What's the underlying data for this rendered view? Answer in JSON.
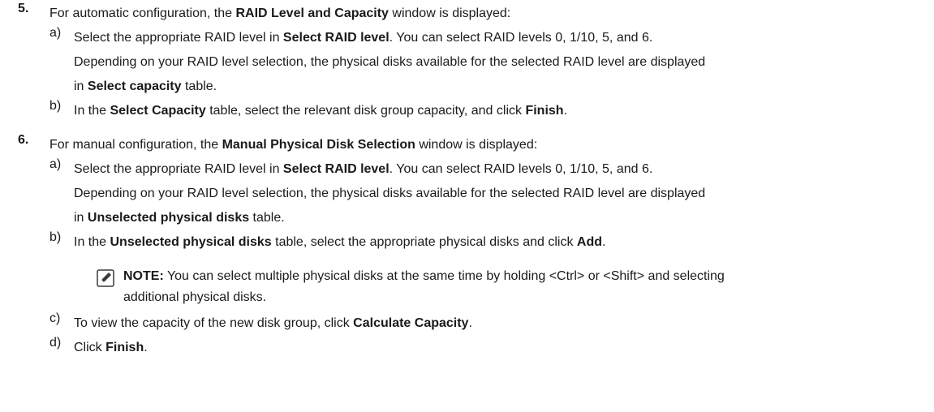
{
  "steps": [
    {
      "number": "5.",
      "intro": {
        "t1": "For automatic configuration, the ",
        "b1": "RAID Level and Capacity",
        "t2": " window is displayed:"
      },
      "substeps": [
        {
          "letter": "a)",
          "line1": {
            "t1": "Select the appropriate RAID level in ",
            "b1": "Select RAID level",
            "t2": ". You can select RAID levels 0, 1/10, 5, and 6."
          },
          "line2": "Depending on your RAID level selection, the physical disks available for the selected RAID level are displayed",
          "line3": {
            "t1": "in ",
            "b1": "Select capacity",
            "t2": " table."
          }
        },
        {
          "letter": "b)",
          "line1": {
            "t1": "In the ",
            "b1": "Select Capacity",
            "t2": " table, select the relevant disk group capacity, and click ",
            "b2": "Finish",
            "t3": "."
          }
        }
      ]
    },
    {
      "number": "6.",
      "intro": {
        "t1": "For manual configuration, the ",
        "b1": "Manual Physical Disk Selection",
        "t2": " window is displayed:"
      },
      "substeps": [
        {
          "letter": "a)",
          "line1": {
            "t1": "Select the appropriate RAID level in ",
            "b1": "Select RAID level",
            "t2": ". You can select RAID levels 0, 1/10, 5, and 6."
          },
          "line2": "Depending on your RAID level selection, the physical disks available for the selected RAID level are displayed",
          "line3": {
            "t1": "in ",
            "b1": "Unselected physical disks",
            "t2": " table."
          }
        },
        {
          "letter": "b)",
          "line1": {
            "t1": "In the ",
            "b1": "Unselected physical disks",
            "t2": " table, select the appropriate physical disks and click ",
            "b2": "Add",
            "t3": "."
          }
        },
        {
          "letter": "c)",
          "line1": {
            "t1": "To view the capacity of the new disk group, click ",
            "b1": "Calculate Capacity",
            "t2": "."
          }
        },
        {
          "letter": "d)",
          "line1": {
            "t1": "Click ",
            "b1": "Finish",
            "t2": "."
          }
        }
      ]
    }
  ],
  "note": {
    "icon": "pencil-note-icon",
    "label": "NOTE:",
    "line1": " You can select multiple physical disks at the same time by holding <Ctrl> or <Shift> and selecting",
    "line2": "additional physical disks."
  },
  "colors": {
    "text": "#1a1a1a",
    "icon_dark": "#3a3a3a"
  }
}
